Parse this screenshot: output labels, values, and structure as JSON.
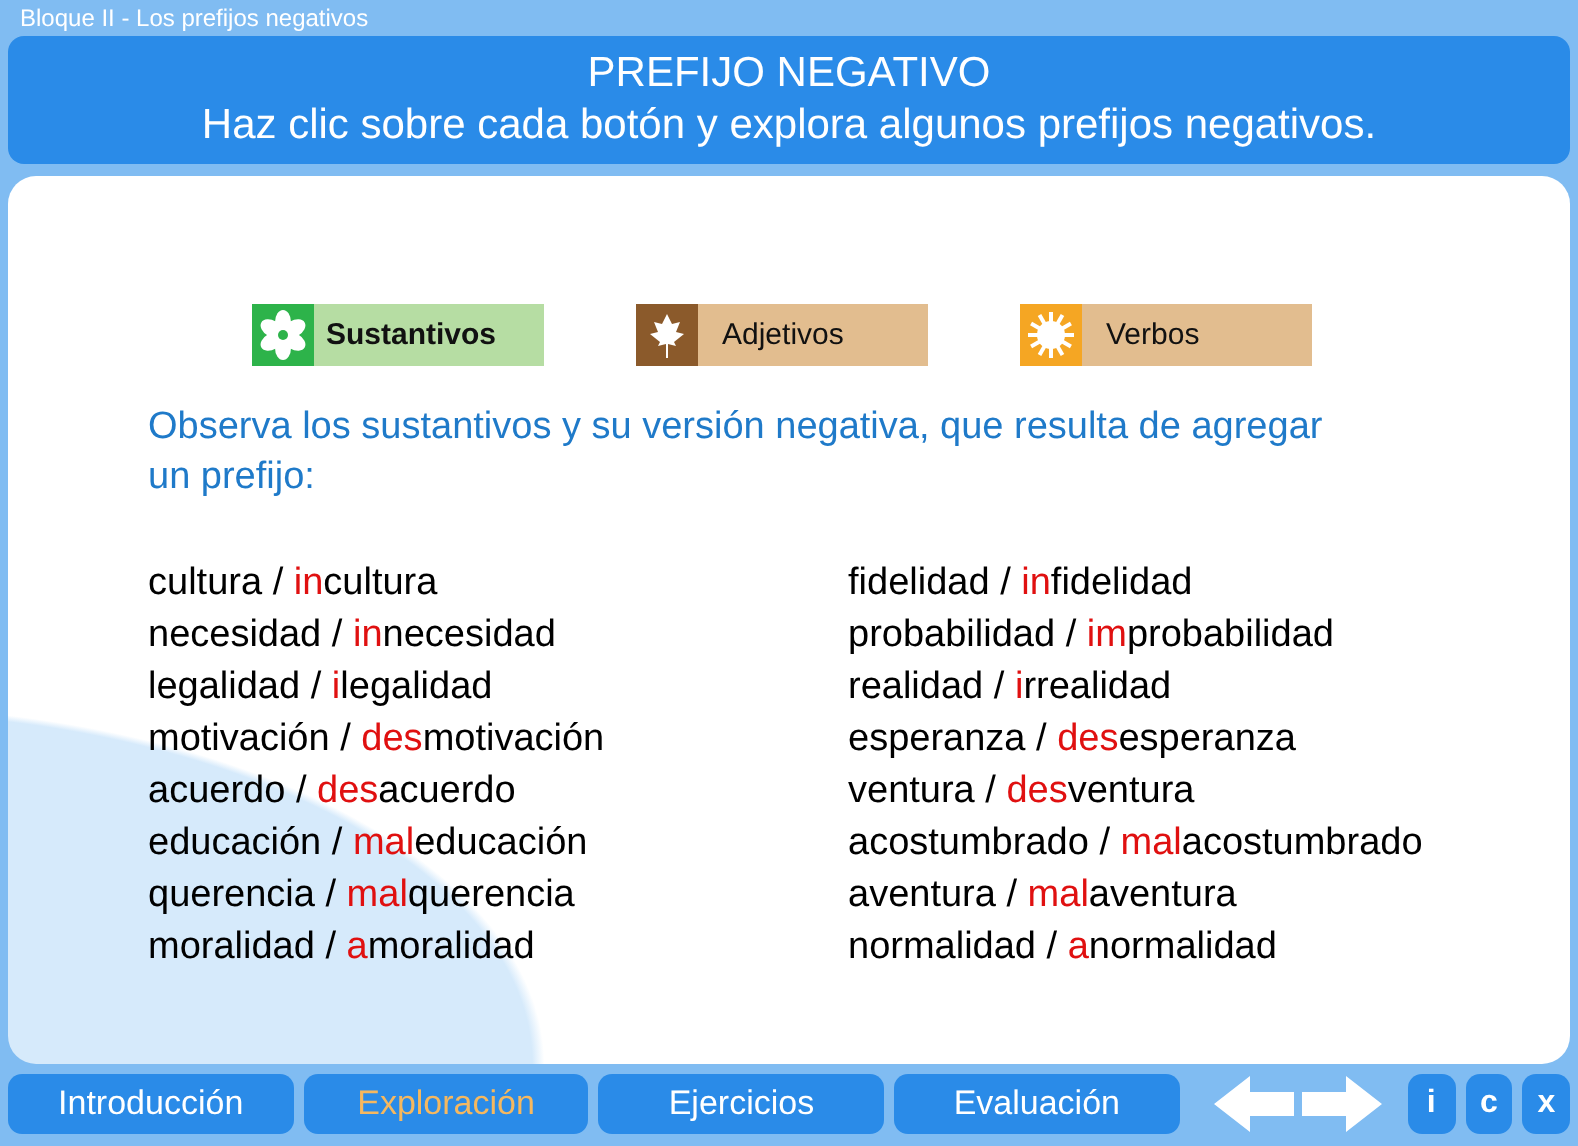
{
  "window": {
    "title": "Bloque II - Los prefijos negativos"
  },
  "header": {
    "title": "PREFIJO NEGATIVO",
    "subtitle": "Haz clic sobre cada botón y explora algunos prefijos negativos."
  },
  "categories": [
    {
      "label": "Sustantivos",
      "kind": "flower",
      "color": "#2db34a",
      "selected": true
    },
    {
      "label": "Adjetivos",
      "kind": "leaf",
      "color": "#8b5a2b",
      "selected": false
    },
    {
      "label": "Verbos",
      "kind": "sun",
      "color": "#f5a623",
      "selected": false
    }
  ],
  "instruction": "Observa los sustantivos y su versión negativa, que resulta de agregar un prefijo:",
  "columns": [
    [
      {
        "word": "cultura",
        "separator": "/",
        "prefix": "in",
        "stem": "cultura"
      },
      {
        "word": "necesidad",
        "separator": "/",
        "prefix": "in",
        "stem": "necesidad"
      },
      {
        "word": "legalidad",
        "separator": "/",
        "prefix": "i",
        "stem": "legalidad"
      },
      {
        "word": "motivación",
        "separator": "/",
        "prefix": "des",
        "stem": "motivación"
      },
      {
        "word": "acuerdo",
        "separator": "/",
        "prefix": "des",
        "stem": "acuerdo"
      },
      {
        "word": "educación",
        "separator": "/",
        "prefix": "mal",
        "stem": "educación"
      },
      {
        "word": "querencia",
        "separator": "/",
        "prefix": "mal",
        "stem": "querencia"
      },
      {
        "word": "moralidad",
        "separator": "/",
        "prefix": "a",
        "stem": "moralidad"
      }
    ],
    [
      {
        "word": "fidelidad",
        "separator": "/",
        "prefix": "in",
        "stem": "fidelidad"
      },
      {
        "word": "probabilidad",
        "separator": "/",
        "prefix": "im",
        "stem": "probabilidad"
      },
      {
        "word": "realidad",
        "separator": "/",
        "prefix": "i",
        "stem": "rrealidad"
      },
      {
        "word": "esperanza",
        "separator": "/",
        "prefix": "des",
        "stem": "esperanza"
      },
      {
        "word": "ventura",
        "separator": "/",
        "prefix": "des",
        "stem": "ventura"
      },
      {
        "word": "acostumbrado",
        "separator": "/",
        "prefix": "mal",
        "stem": "acostumbrado"
      },
      {
        "word": "aventura",
        "separator": "/",
        "prefix": "mal",
        "stem": "aventura"
      },
      {
        "word": "normalidad",
        "separator": "/",
        "prefix": "a",
        "stem": "normalidad"
      }
    ]
  ],
  "nav_tabs": [
    {
      "label": "Introducción",
      "selected": false
    },
    {
      "label": "Exploración",
      "selected": true
    },
    {
      "label": "Ejercicios",
      "selected": false
    },
    {
      "label": "Evaluación",
      "selected": false
    }
  ],
  "tool_buttons": [
    "i",
    "c",
    "x"
  ]
}
